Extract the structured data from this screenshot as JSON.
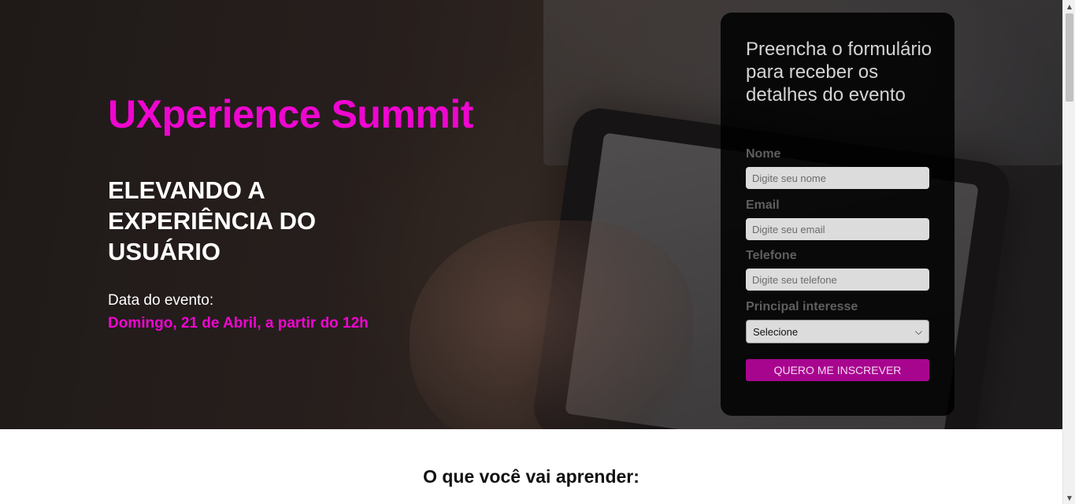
{
  "hero": {
    "title": "UXperience Summit",
    "subtitle": "ELEVANDO A EXPERIÊNCIA DO USUÁRIO",
    "date_label": "Data do evento:",
    "date_value": "Domingo, 21 de Abril, a partir do 12h"
  },
  "form": {
    "heading": "Preencha o formulário para receber os detalhes do evento",
    "name_label": "Nome",
    "name_placeholder": "Digite seu nome",
    "email_label": "Email",
    "email_placeholder": "Digite seu email",
    "phone_label": "Telefone",
    "phone_placeholder": "Digite seu telefone",
    "interest_label": "Principal interesse",
    "interest_selected": "Selecione",
    "submit_label": "QUERO ME INSCREVER"
  },
  "section": {
    "learn_title": "O que você vai aprender:"
  },
  "colors": {
    "accent": "#ee06d0",
    "button": "#a8058f",
    "card": "#000000"
  },
  "icons": {
    "select_chevron": "chevron-down-icon",
    "scroll_up": "triangle-up-icon",
    "scroll_down": "triangle-down-icon"
  }
}
